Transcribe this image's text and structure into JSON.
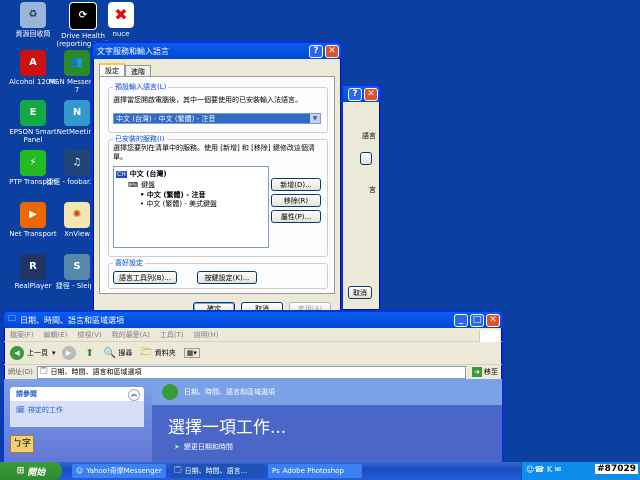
{
  "desktop_icons": [
    {
      "label": "資源回收筒",
      "icon": "recycle-bin-icon"
    },
    {
      "label": "Drive Health (reporting tool)",
      "icon": "drive-health-icon"
    },
    {
      "label": "nuce",
      "icon": "nuce-icon"
    },
    {
      "label": "Alcohol 120%",
      "icon": "alcohol-icon"
    },
    {
      "label": "MSN Messenger 7",
      "icon": "msn-icon"
    },
    {
      "label": "EPSON Smart Panel",
      "icon": "epson-icon"
    },
    {
      "label": "NetMeeting",
      "icon": "netmeeting-icon"
    },
    {
      "label": "PTP Transport",
      "icon": "ptp-icon"
    },
    {
      "label": "捷徑 - foobar2000",
      "icon": "foobar-icon"
    },
    {
      "label": "Net Transport",
      "icon": "nettransport-icon"
    },
    {
      "label": "XnView",
      "icon": "xnview-icon"
    },
    {
      "label": "RealPlayer",
      "icon": "realplayer-icon"
    },
    {
      "label": "捷徑 - Sleipn",
      "icon": "sleipnir-icon"
    }
  ],
  "dialog": {
    "title": "文字服務和輸入語言",
    "tabs": [
      "設定",
      "進階"
    ],
    "default_lang_group": "預設輸入語言(L)",
    "default_lang_desc": "選擇當您開啟電腦後，其中一個要使用的已安裝輸入法語言。",
    "default_lang_value": "中文 (台灣) - 中文 (繁體) - 注音",
    "installed_group": "已安裝的服務(I)",
    "installed_desc": "選擇您要列在清單中的服務。使用 [新增] 和 [移除] 鍵修改這個清單。",
    "tree": {
      "lang_code": "CH",
      "lang": "中文 (台灣)",
      "keyboard": "鍵盤",
      "item1": "中文 (繁體) - 注音",
      "item2": "中文 (繁體) - 美式鍵盤"
    },
    "add_btn": "新增(D)...",
    "remove_btn": "移除(R)",
    "props_btn": "屬性(P)...",
    "pref_group": "喜好設定",
    "langbar_btn": "語言工具列(B)...",
    "keyset_btn": "按鍵設定(K)...",
    "ok": "確定",
    "cancel": "取消",
    "apply": "套用(A)"
  },
  "bg_dialog": {
    "frag1": "語言",
    "frag2": "言",
    "frag3": "取消"
  },
  "explorer": {
    "title": "日期、時間、語言和區域選項",
    "menu": [
      "檔案(F)",
      "編輯(E)",
      "檢視(V)",
      "我的最愛(A)",
      "工具(T)",
      "說明(H)"
    ],
    "back": "上一頁",
    "search": "搜尋",
    "folders": "資料夾",
    "address_label": "網址(D)",
    "address_value": "日期、時間、語言和區域選項",
    "go": "移至",
    "see_also": "請參閱",
    "scheduled": "排定的工作",
    "header": "日期、時間、語言和區域選項",
    "pick_task": "選擇一項工作...",
    "task1": "變更日期和時間"
  },
  "taskbar": {
    "start": "開始",
    "tasks": [
      "Yahoo!奇摩Messenger",
      "日期、時間、語言...",
      "Adobe Photoshop"
    ],
    "clock": "#87029"
  },
  "colors": {
    "xp_blue": "#0a5ff0",
    "desktop": "#0b3fa0",
    "close_red": "#e3512b",
    "start_green": "#3c9a3c"
  }
}
